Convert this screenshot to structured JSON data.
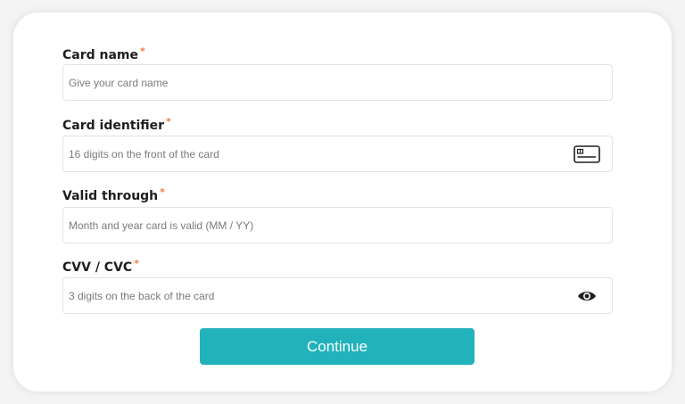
{
  "form": {
    "required_marker": "*",
    "fields": [
      {
        "label": "Card name",
        "placeholder": "Give your card name",
        "icon": ""
      },
      {
        "label": "Card identifier",
        "placeholder": "16 digits on the front of the card",
        "icon": "credit-card-icon"
      },
      {
        "label": "Valid through",
        "placeholder": "Month and year card is valid (MM / YY)",
        "icon": ""
      },
      {
        "label": "CVV / CVC",
        "placeholder": "3 digits on the back of the card",
        "icon": "eye-icon"
      }
    ],
    "submit_label": "Continue"
  },
  "colors": {
    "accent": "#21b2bc",
    "required": "#f07c3a",
    "label": "#1e1e1e",
    "input_border": "#e2e2e2"
  }
}
